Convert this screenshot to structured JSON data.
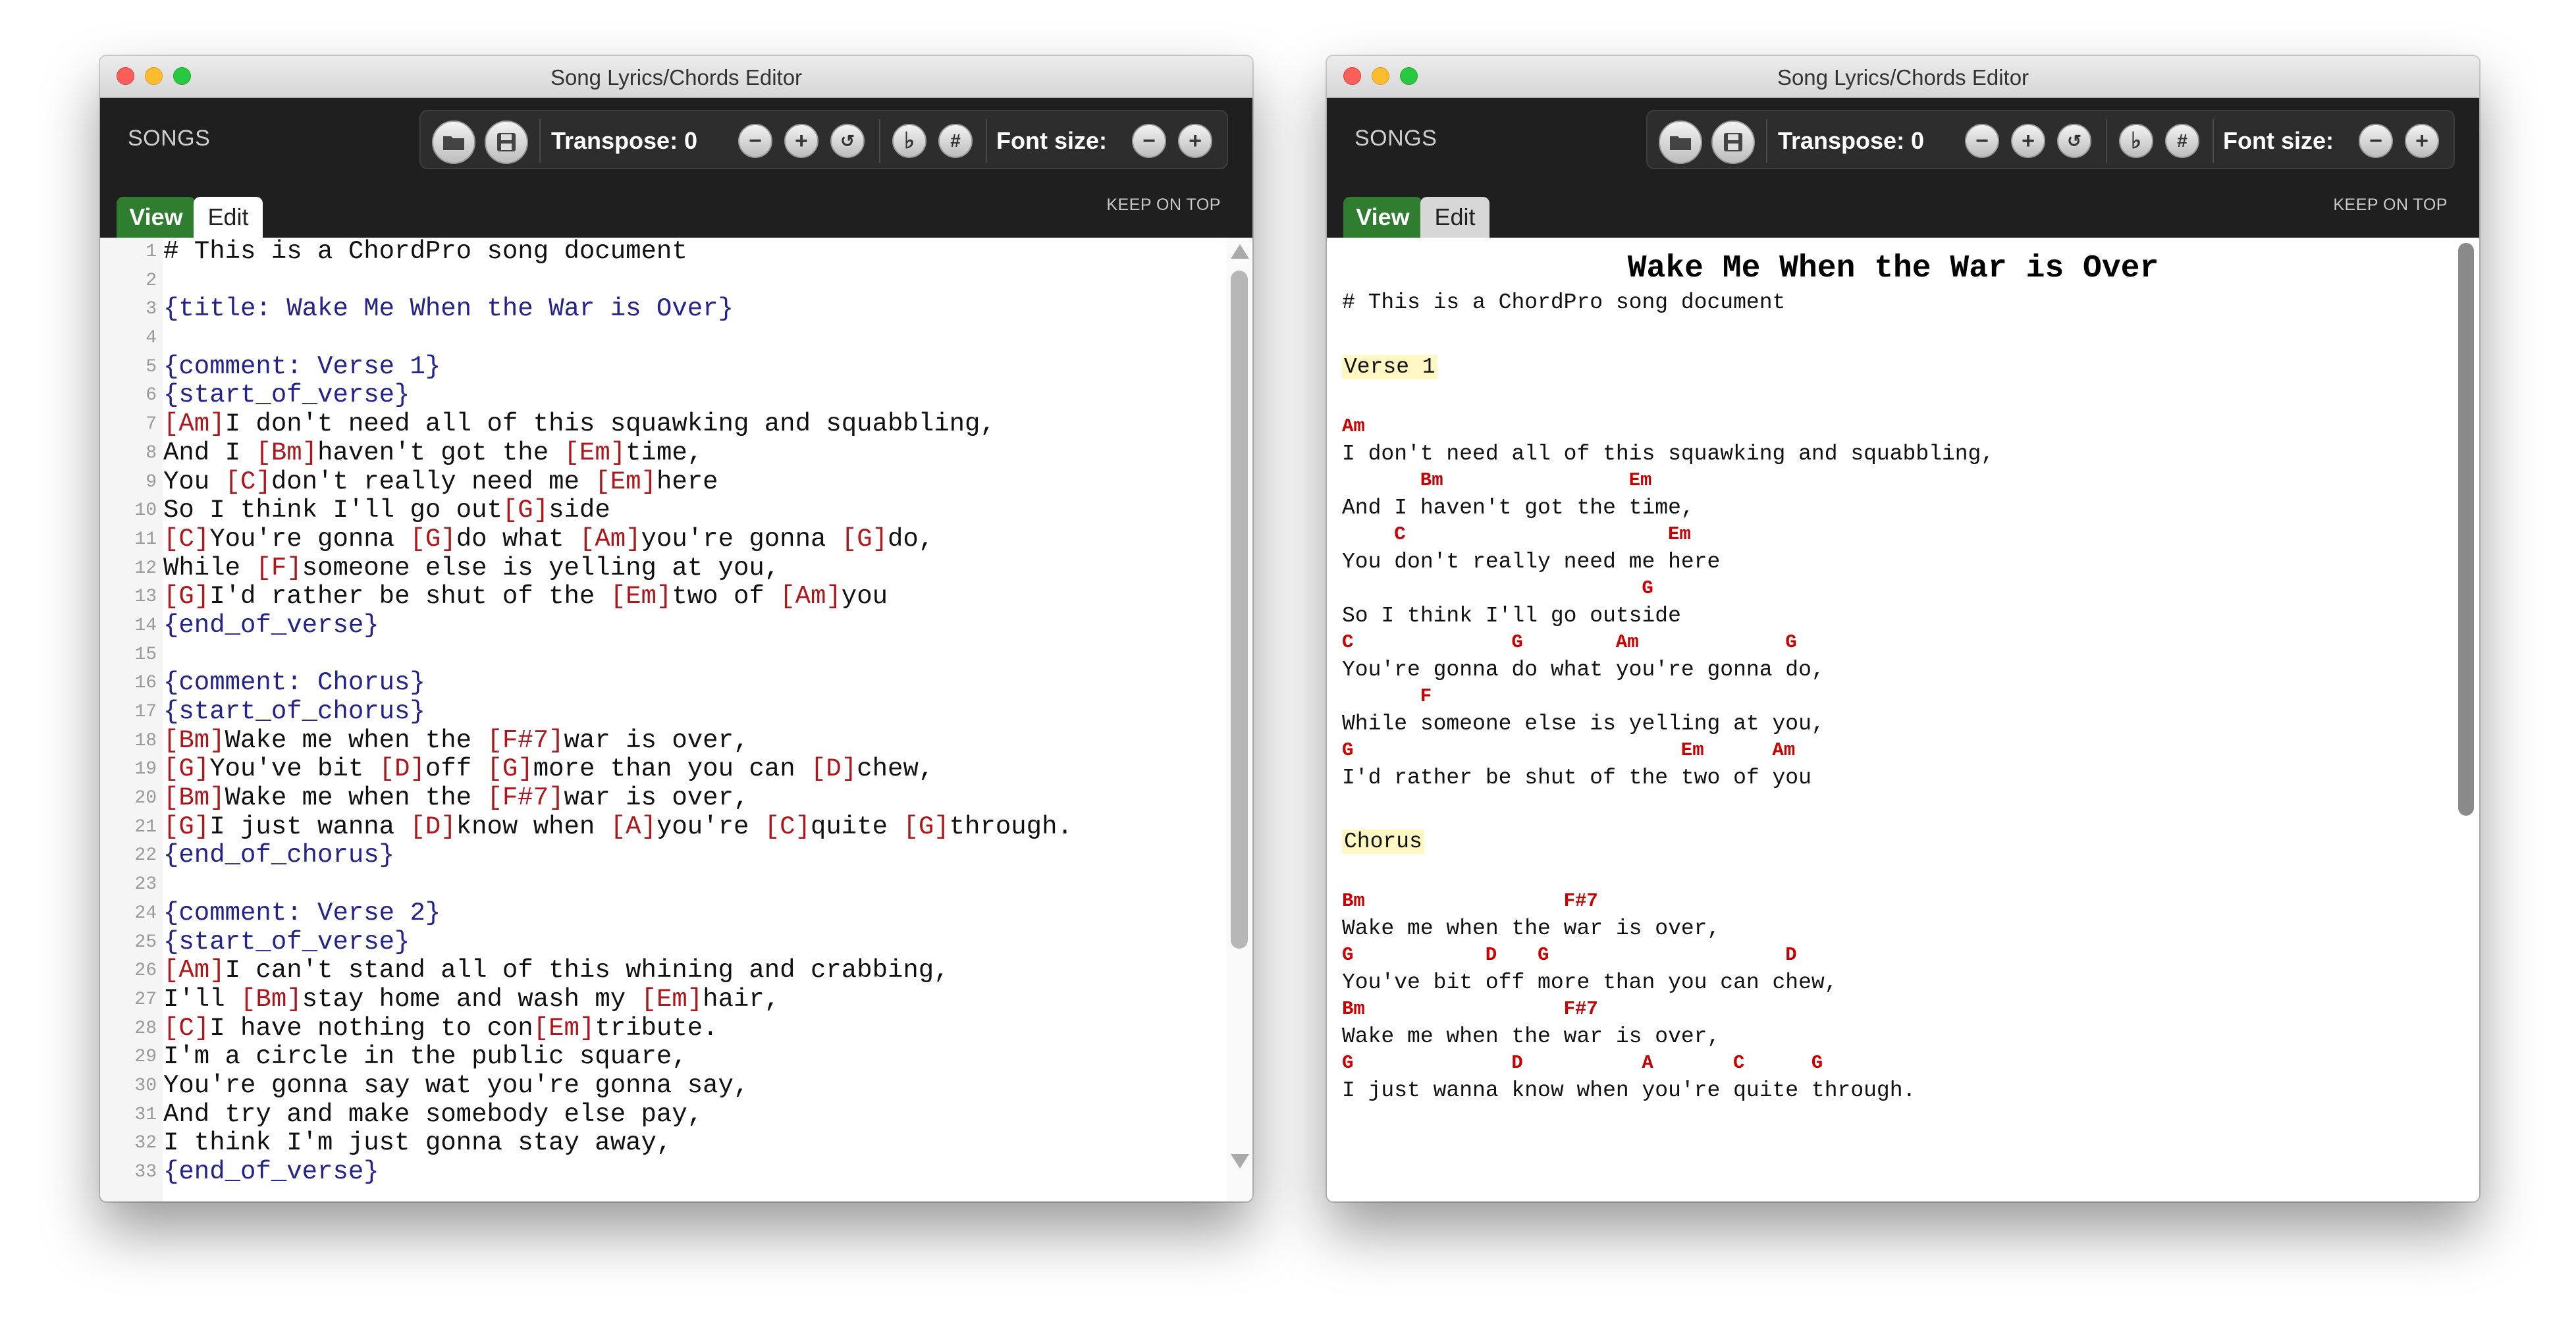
{
  "app_title": "Song Lyrics/Chords Editor",
  "toolbar": {
    "songs_label": "SONGS",
    "transpose_label": "Transpose: 0",
    "font_size_label": "Font size:",
    "keep_on_top_label": "KEEP ON TOP",
    "buttons": {
      "open": "folder-icon",
      "save": "floppy-disk-icon",
      "transpose_down": "minus-circle-icon",
      "transpose_up": "plus-circle-icon",
      "transpose_reset": "reset-icon",
      "flat": "♭",
      "sharp": "#",
      "font_smaller": "minus-circle-icon",
      "font_larger": "plus-circle-icon"
    }
  },
  "tabs": {
    "view": "View",
    "edit": "Edit"
  },
  "editor": {
    "lines": [
      {
        "n": "1",
        "t": "# This is a ChordPro song document",
        "kind": "plain"
      },
      {
        "n": "2",
        "t": "",
        "kind": "plain"
      },
      {
        "n": "3",
        "t": "{title: Wake Me When the War is Over}",
        "kind": "directive"
      },
      {
        "n": "4",
        "t": "",
        "kind": "plain"
      },
      {
        "n": "5",
        "t": "{comment: Verse 1}",
        "kind": "directive"
      },
      {
        "n": "6",
        "t": "{start_of_verse}",
        "kind": "directive"
      },
      {
        "n": "7",
        "t": "[Am]I don't need all of this squawking and squabbling,",
        "kind": "lyric"
      },
      {
        "n": "8",
        "t": "And I [Bm]haven't got the [Em]time,",
        "kind": "lyric"
      },
      {
        "n": "9",
        "t": "You [C]don't really need me [Em]here",
        "kind": "lyric"
      },
      {
        "n": "10",
        "t": "So I think I'll go out[G]side",
        "kind": "lyric"
      },
      {
        "n": "11",
        "t": "[C]You're gonna [G]do what [Am]you're gonna [G]do,",
        "kind": "lyric"
      },
      {
        "n": "12",
        "t": "While [F]someone else is yelling at you,",
        "kind": "lyric"
      },
      {
        "n": "13",
        "t": "[G]I'd rather be shut of the [Em]two of [Am]you",
        "kind": "lyric"
      },
      {
        "n": "14",
        "t": "{end_of_verse}",
        "kind": "directive"
      },
      {
        "n": "15",
        "t": "",
        "kind": "plain"
      },
      {
        "n": "16",
        "t": "{comment: Chorus}",
        "kind": "directive"
      },
      {
        "n": "17",
        "t": "{start_of_chorus}",
        "kind": "directive"
      },
      {
        "n": "18",
        "t": "[Bm]Wake me when the [F#7]war is over,",
        "kind": "lyric"
      },
      {
        "n": "19",
        "t": "[G]You've bit [D]off [G]more than you can [D]chew,",
        "kind": "lyric"
      },
      {
        "n": "20",
        "t": "[Bm]Wake me when the [F#7]war is over,",
        "kind": "lyric"
      },
      {
        "n": "21",
        "t": "[G]I just wanna [D]know when [A]you're [C]quite [G]through.",
        "kind": "lyric"
      },
      {
        "n": "22",
        "t": "{end_of_chorus}",
        "kind": "directive"
      },
      {
        "n": "23",
        "t": "",
        "kind": "plain"
      },
      {
        "n": "24",
        "t": "{comment: Verse 2}",
        "kind": "directive"
      },
      {
        "n": "25",
        "t": "{start_of_verse}",
        "kind": "directive"
      },
      {
        "n": "26",
        "t": "[Am]I can't stand all of this whining and crabbing,",
        "kind": "lyric"
      },
      {
        "n": "27",
        "t": "I'll [Bm]stay home and wash my [Em]hair,",
        "kind": "lyric"
      },
      {
        "n": "28",
        "t": "[C]I have nothing to con[Em]tribute.",
        "kind": "lyric"
      },
      {
        "n": "29",
        "t": "I'm a circle in the public square,",
        "kind": "lyric"
      },
      {
        "n": "30",
        "t": "You're gonna say wat you're gonna say,",
        "kind": "lyric"
      },
      {
        "n": "31",
        "t": "And try and make somebody else pay,",
        "kind": "lyric"
      },
      {
        "n": "32",
        "t": "I think I'm just gonna stay away,",
        "kind": "lyric"
      },
      {
        "n": "33",
        "t": "{end_of_verse}",
        "kind": "directive"
      }
    ]
  },
  "preview": {
    "title": "Wake Me When the War is Over",
    "blocks": [
      {
        "type": "text",
        "text": "# This is a ChordPro song document"
      },
      {
        "type": "gap"
      },
      {
        "type": "comment",
        "text": "Verse 1"
      },
      {
        "type": "gap"
      },
      {
        "type": "pair",
        "chords": [
          {
            "col": 0,
            "c": "Am"
          }
        ],
        "lyric": "I don't need all of this squawking and squabbling,"
      },
      {
        "type": "pair",
        "chords": [
          {
            "col": 6,
            "c": "Bm"
          },
          {
            "col": 22,
            "c": "Em"
          }
        ],
        "lyric": "And I haven't got the time,"
      },
      {
        "type": "pair",
        "chords": [
          {
            "col": 4,
            "c": "C"
          },
          {
            "col": 25,
            "c": "Em"
          }
        ],
        "lyric": "You don't really need me here"
      },
      {
        "type": "pair",
        "chords": [
          {
            "col": 23,
            "c": "G"
          }
        ],
        "lyric": "So I think I'll go outside"
      },
      {
        "type": "pair",
        "chords": [
          {
            "col": 0,
            "c": "C"
          },
          {
            "col": 13,
            "c": "G"
          },
          {
            "col": 21,
            "c": "Am"
          },
          {
            "col": 34,
            "c": "G"
          }
        ],
        "lyric": "You're gonna do what you're gonna do,"
      },
      {
        "type": "pair",
        "chords": [
          {
            "col": 6,
            "c": "F"
          }
        ],
        "lyric": "While someone else is yelling at you,"
      },
      {
        "type": "pair",
        "chords": [
          {
            "col": 0,
            "c": "G"
          },
          {
            "col": 26,
            "c": "Em"
          },
          {
            "col": 33,
            "c": "Am"
          }
        ],
        "lyric": "I'd rather be shut of the two of you"
      },
      {
        "type": "gap"
      },
      {
        "type": "comment",
        "text": "Chorus"
      },
      {
        "type": "gap"
      },
      {
        "type": "pair",
        "chords": [
          {
            "col": 0,
            "c": "Bm"
          },
          {
            "col": 17,
            "c": "F#7"
          }
        ],
        "lyric": "Wake me when the war is over,"
      },
      {
        "type": "pair",
        "chords": [
          {
            "col": 0,
            "c": "G"
          },
          {
            "col": 11,
            "c": "D"
          },
          {
            "col": 15,
            "c": "G"
          },
          {
            "col": 34,
            "c": "D"
          }
        ],
        "lyric": "You've bit off more than you can chew,"
      },
      {
        "type": "pair",
        "chords": [
          {
            "col": 0,
            "c": "Bm"
          },
          {
            "col": 17,
            "c": "F#7"
          }
        ],
        "lyric": "Wake me when the war is over,"
      },
      {
        "type": "pair",
        "chords": [
          {
            "col": 0,
            "c": "G"
          },
          {
            "col": 13,
            "c": "D"
          },
          {
            "col": 23,
            "c": "A"
          },
          {
            "col": 30,
            "c": "C"
          },
          {
            "col": 36,
            "c": "G"
          }
        ],
        "lyric": "I just wanna know when you're quite through."
      }
    ]
  }
}
